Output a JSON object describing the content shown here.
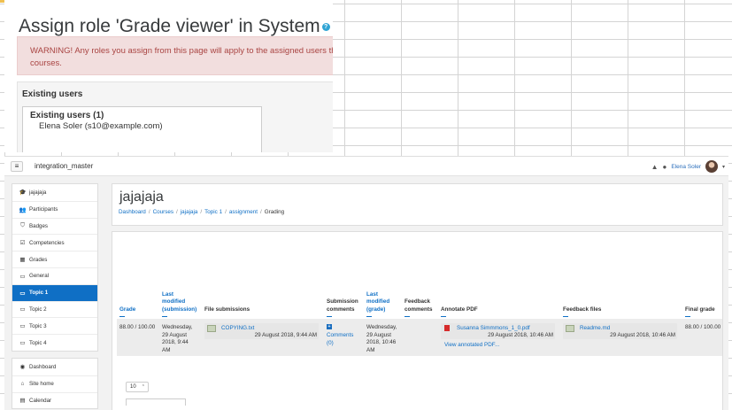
{
  "back_window": {
    "title": "Assign role 'Grade viewer' in System",
    "help_icon": "?",
    "warning_line1": "WARNING! Any roles you assign from this page will apply to the assigned users thro",
    "warning_line2": "courses.",
    "existing_heading": "Existing users",
    "existing_list_heading": "Existing users (1)",
    "existing_user": "Elena Soler (s10@example.com)"
  },
  "navbar": {
    "menu_icon": "≡",
    "site_name": "integration_master",
    "bell_icon": "▲",
    "message_icon": "●",
    "user_name": "Elena Soler",
    "caret": "▾"
  },
  "sidebar": {
    "course_items": [
      {
        "label": "jajajaja",
        "icon": "🎓"
      },
      {
        "label": "Participants",
        "icon": "👥"
      },
      {
        "label": "Badges",
        "icon": "⛉"
      },
      {
        "label": "Competencies",
        "icon": "☑"
      },
      {
        "label": "Grades",
        "icon": "▦"
      },
      {
        "label": "General",
        "icon": "▭"
      },
      {
        "label": "Topic 1",
        "icon": "▭",
        "active": true
      },
      {
        "label": "Topic 2",
        "icon": "▭"
      },
      {
        "label": "Topic 3",
        "icon": "▭"
      },
      {
        "label": "Topic 4",
        "icon": "▭"
      }
    ],
    "site_items": [
      {
        "label": "Dashboard",
        "icon": "◉"
      },
      {
        "label": "Site home",
        "icon": "⌂"
      },
      {
        "label": "Calendar",
        "icon": "▤"
      }
    ]
  },
  "header": {
    "title": "jajajaja",
    "breadcrumb": [
      "Dashboard",
      "Courses",
      "jajajaja",
      "Topic 1",
      "assignment",
      "Grading"
    ]
  },
  "table": {
    "headers": {
      "grade": "Grade",
      "last_modified_submission": [
        "Last",
        "modified",
        "(submission)"
      ],
      "file_submissions": "File submissions",
      "submission_comments": [
        "Submission",
        "comments"
      ],
      "last_modified_grade": [
        "Last",
        "modified",
        "(grade)"
      ],
      "feedback_comments": [
        "Feedback",
        "comments"
      ],
      "annotate_pdf": "Annotate PDF",
      "feedback_files": "Feedback files",
      "final_grade": "Final grade"
    },
    "row": {
      "grade": "88.00 / 100.00",
      "last_modified_submission": [
        "Wednesday,",
        "29 August",
        "2018, 9:44",
        "AM"
      ],
      "file_name": "COPYING.txt",
      "file_date": "29 August 2018, 9:44 AM",
      "comments_label": [
        "Comments",
        "(0)"
      ],
      "last_modified_grade": [
        "Wednesday,",
        "29 August",
        "2018, 10:46",
        "AM"
      ],
      "pdf_name": "Susanna Simmmons_1_0.pdf",
      "pdf_date": "29 August 2018, 10:46 AM",
      "view_annotated": "View annotated PDF...",
      "feedback_file": "Readme.md",
      "feedback_date": "29 August 2018, 10:46 AM",
      "final_grade": "88.00 / 100.00"
    }
  },
  "per_page": {
    "value": "10",
    "chevron": "⌃"
  }
}
